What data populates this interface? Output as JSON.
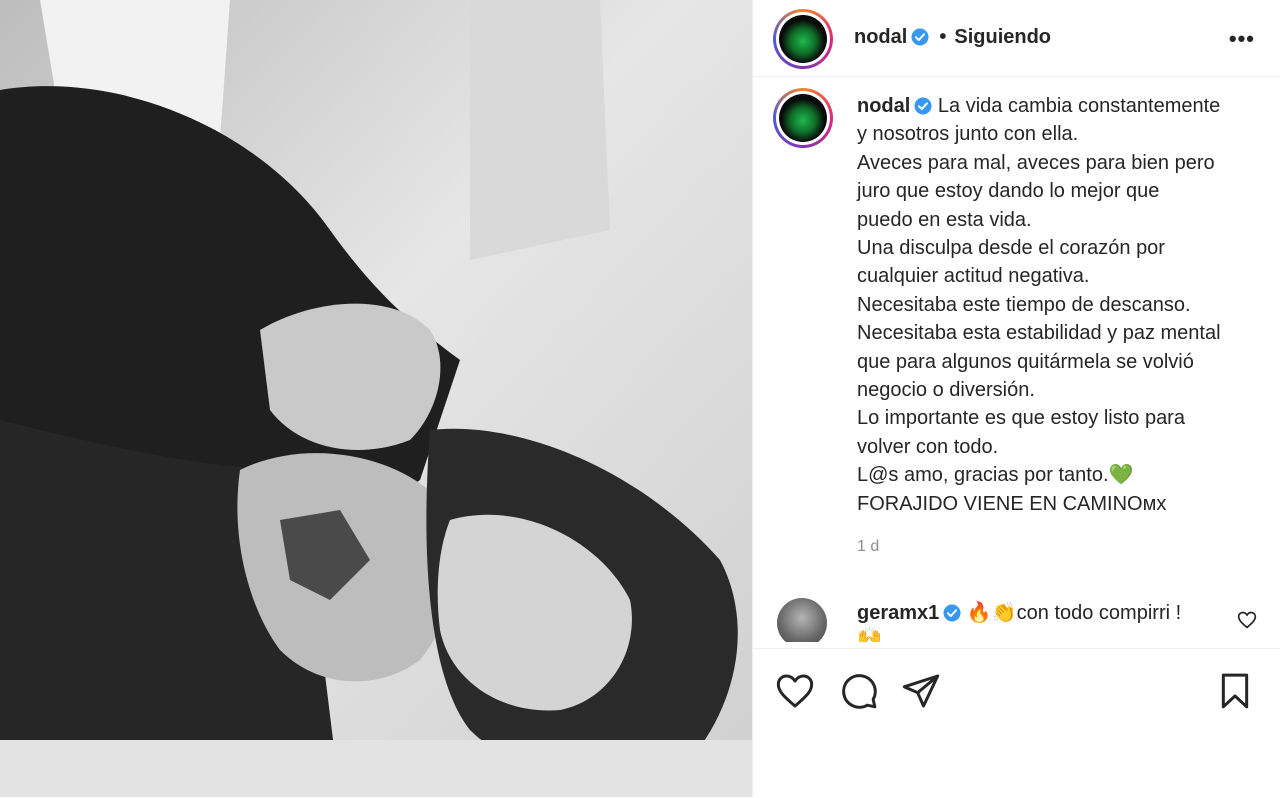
{
  "header": {
    "username": "nodal",
    "separator": "•",
    "follow_status": "Siguiendo",
    "more_label": "•••"
  },
  "caption": {
    "username": "nodal",
    "lines": [
      "La vida cambia constantemente",
      "y nosotros junto con ella.",
      "Aveces para mal, aveces para bien pero",
      "juro que estoy dando lo mejor que",
      "puedo en esta vida.",
      "Una disculpa desde el corazón por",
      "cualquier actitud negativa.",
      "Necesitaba este tiempo de descanso.",
      "Necesitaba esta estabilidad y paz mental",
      "que para algunos quitármela se volvió",
      "negocio o diversión.",
      "Lo importante es que estoy listo para",
      "volver con todo.",
      "L@s amo, gracias por tanto.💚",
      "FORAJIDO VIENE EN CAMINOᴍx"
    ],
    "time_ago": "1 d"
  },
  "comment": {
    "username": "geramx1",
    "text": "🔥👏con todo compirri !",
    "second_line": "🙌"
  },
  "icons": {
    "like": "heart-icon",
    "comment": "comment-icon",
    "share": "send-icon",
    "save": "bookmark-icon",
    "verified": "verified-badge-icon",
    "more": "more-options-icon"
  },
  "colors": {
    "verified": "#3897f0",
    "text": "#262626",
    "secondary": "#8e8e8e",
    "border": "#efefef"
  }
}
